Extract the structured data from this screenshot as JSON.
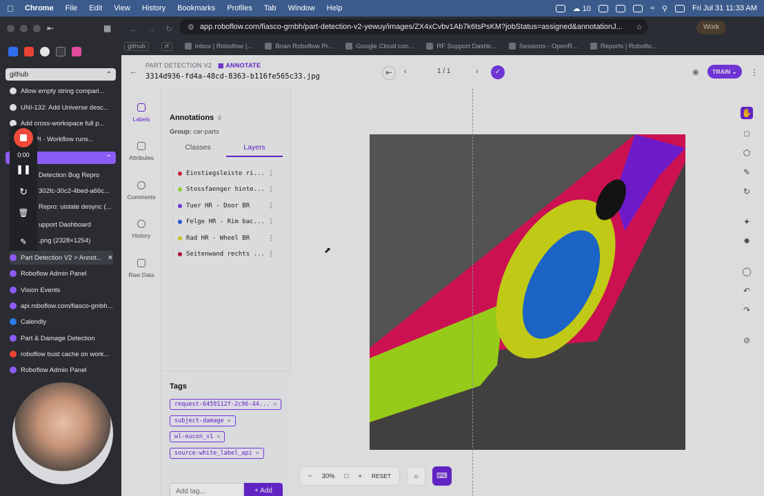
{
  "menubar": {
    "app": "Chrome",
    "menus": [
      "File",
      "Edit",
      "View",
      "History",
      "Bookmarks",
      "Profiles",
      "Tab",
      "Window",
      "Help"
    ],
    "badge_count": "10",
    "datetime": "Fri Jul 31  11:33 AM"
  },
  "browser": {
    "url": "app.roboflow.com/fiasco-gmbh/part-detection-v2-yewuy/images/ZX4xCvbv1Ab7k6tsPsKM?jobStatus=assigned&annotationJ...",
    "profile": "Work",
    "bookmarks": [
      {
        "label": "github"
      },
      {
        "label": "rf"
      },
      {
        "label": "Inbox | Roboflow |..."
      },
      {
        "label": "Brian Roboflow Pr..."
      },
      {
        "label": "Google Cloud con..."
      },
      {
        "label": "RF Support Dashb..."
      },
      {
        "label": "Sessions - OpenR..."
      },
      {
        "label": "Reports | Roboflo..."
      }
    ]
  },
  "sidebar": {
    "group1": "github",
    "group1_tabs": [
      "Allow empty string compari...",
      "UNI-132: Add Universe desc...",
      "Add cross-workspace full p...",
      "loy API · Workflow runs..."
    ],
    "group2_tabs": [
      "Detection Bug Repro",
      "302fc-30c2-4bed-a66c...",
      "Repro: uistate desync (...",
      "upport Dashboard",
      ".png (2328×1254)"
    ],
    "tabs": [
      "Part Detection V2 > Annot...",
      "Roboflow Admin Panel",
      "Vision Events",
      "api.roboflow.com/fiasco-gmbh...",
      "Calendly",
      "Part & Damage Detection",
      "roboflow bust cache on work...",
      "Roboflow Admin Panel"
    ],
    "recorder_time": "0:00"
  },
  "header": {
    "crumb_project": "PART DETECTION V2",
    "crumb_mode": "ANNOTATE",
    "filename": "3314d936-fd4a-48cd-8363-b116fe565c33.jpg",
    "pager": "1 / 1",
    "train_label": "TRAIN"
  },
  "rail": [
    "Labels",
    "Attributes",
    "Comments",
    "History",
    "Raw Data"
  ],
  "panel": {
    "title": "Annotations",
    "count": "6",
    "group_label": "Group:",
    "group_value": "car-parts",
    "tab_classes": "Classes",
    "tab_layers": "Layers",
    "annotations": [
      {
        "label": "Einstiegsleiste ri...",
        "color": "#e11d48"
      },
      {
        "label": "Stossfaenger hinte...",
        "color": "#a3e635"
      },
      {
        "label": "Tuer HR - Door BR",
        "color": "#7c3aed"
      },
      {
        "label": "Felge HR - Rim bac...",
        "color": "#2563eb"
      },
      {
        "label": "Rad HR - Wheel BR",
        "color": "#d9e021"
      },
      {
        "label": "Seitenwand rechts ...",
        "color": "#be123c"
      }
    ],
    "tags_title": "Tags",
    "tags": [
      "request-6459112f-2c96-44...",
      "subject-damage",
      "wl-eucon_v1",
      "source-white_label_api"
    ],
    "add_placeholder": "Add tag...",
    "add_label": "+ Add"
  },
  "canvas": {
    "zoom": "30%",
    "reset": "RESET"
  }
}
